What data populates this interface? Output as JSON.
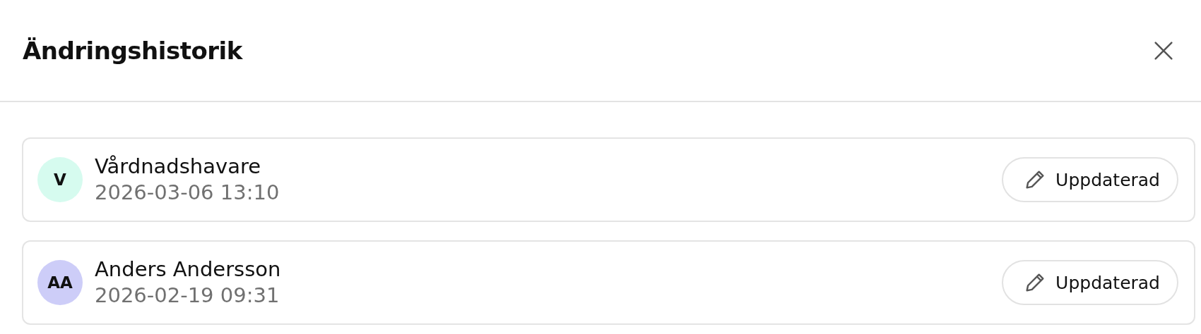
{
  "dialog": {
    "title": "Ändringshistorik"
  },
  "entries": [
    {
      "initials": "V",
      "color": "#d6fbef",
      "name": "Vårdnadshavare",
      "timestamp": "2026-03-06 13:10",
      "action": "Uppdaterad"
    },
    {
      "initials": "AA",
      "color": "#cdcdf8",
      "name": "Anders Andersson",
      "timestamp": "2026-02-19 09:31",
      "action": "Uppdaterad"
    }
  ]
}
